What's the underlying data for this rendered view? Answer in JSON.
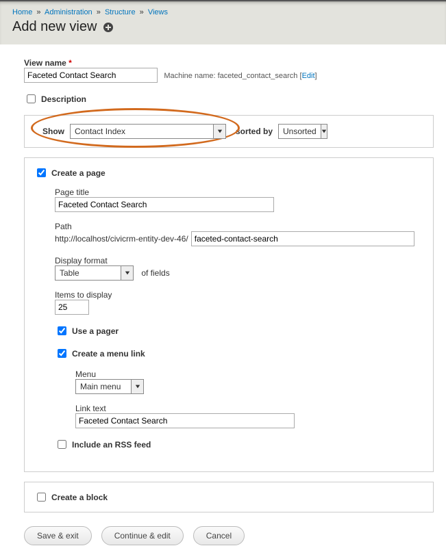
{
  "breadcrumb": {
    "home": "Home",
    "administration": "Administration",
    "structure": "Structure",
    "views": "Views"
  },
  "page_title": "Add new view",
  "view_name": {
    "label": "View name",
    "value": "Faceted Contact Search",
    "machine_label": "Machine name:",
    "machine_value": "faceted_contact_search",
    "edit": "Edit"
  },
  "description_label": "Description",
  "show": {
    "label": "Show",
    "value": "Contact Index",
    "sorted_by_label": "sorted by",
    "sorted_by_value": "Unsorted"
  },
  "create_page": {
    "label": "Create a page",
    "page_title_label": "Page title",
    "page_title_value": "Faceted Contact Search",
    "path_label": "Path",
    "path_base": "http://localhost/civicrm-entity-dev-46/",
    "path_value": "faceted-contact-search",
    "display_format_label": "Display format",
    "display_format_value": "Table",
    "of_fields": "of fields",
    "items_label": "Items to display",
    "items_value": "25",
    "use_pager_label": "Use a pager",
    "menu_link_label": "Create a menu link",
    "menu_label": "Menu",
    "menu_value": "Main menu",
    "link_text_label": "Link text",
    "link_text_value": "Faceted Contact Search",
    "rss_label": "Include an RSS feed"
  },
  "create_block_label": "Create a block",
  "buttons": {
    "save": "Save & exit",
    "continue": "Continue & edit",
    "cancel": "Cancel"
  }
}
